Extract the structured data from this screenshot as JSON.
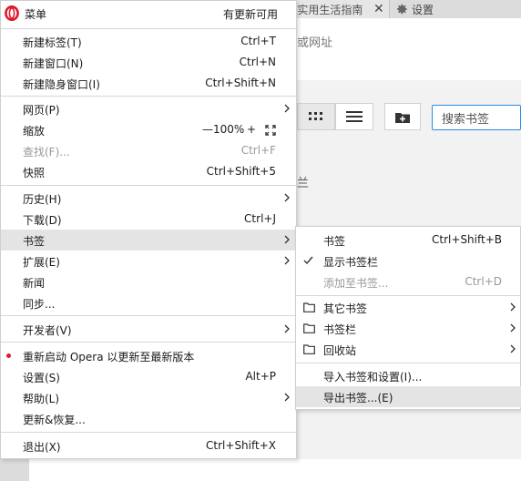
{
  "background": {
    "tab_title": "-实用生活指南",
    "settings_label": "设置",
    "address_fragment": "或网址",
    "bookmark_search_placeholder": "搜索书签",
    "content_fragment": "兰"
  },
  "menu": {
    "title": "菜单",
    "update_status": "有更新可用",
    "items": [
      {
        "label": "新建标签(T)",
        "shortcut": "Ctrl+T"
      },
      {
        "label": "新建窗口(N)",
        "shortcut": "Ctrl+N"
      },
      {
        "label": "新建隐身窗口(I)",
        "shortcut": "Ctrl+Shift+N"
      },
      {
        "label": "网页(P)",
        "shortcut": ""
      },
      {
        "label": "缩放",
        "shortcut": ""
      },
      {
        "label": "查找(F)...",
        "shortcut": "Ctrl+F"
      },
      {
        "label": "快照",
        "shortcut": "Ctrl+Shift+5"
      },
      {
        "label": "历史(H)",
        "shortcut": ""
      },
      {
        "label": "下载(D)",
        "shortcut": "Ctrl+J"
      },
      {
        "label": "书签",
        "shortcut": ""
      },
      {
        "label": "扩展(E)",
        "shortcut": ""
      },
      {
        "label": "新闻",
        "shortcut": ""
      },
      {
        "label": "同步...",
        "shortcut": ""
      },
      {
        "label": "开发者(V)",
        "shortcut": ""
      },
      {
        "label": "重新启动 Opera 以更新至最新版本",
        "shortcut": ""
      },
      {
        "label": "设置(S)",
        "shortcut": "Alt+P"
      },
      {
        "label": "帮助(L)",
        "shortcut": ""
      },
      {
        "label": "更新&恢复...",
        "shortcut": ""
      },
      {
        "label": "退出(X)",
        "shortcut": "Ctrl+Shift+X"
      }
    ],
    "zoom": {
      "minus": "—",
      "value": "100%",
      "plus": "+"
    }
  },
  "bookmarks_submenu": {
    "items": [
      {
        "label": "书签",
        "shortcut": "Ctrl+Shift+B"
      },
      {
        "label": "显示书签栏",
        "shortcut": ""
      },
      {
        "label": "添加至书签...",
        "shortcut": "Ctrl+D"
      },
      {
        "label": "其它书签",
        "shortcut": ""
      },
      {
        "label": "书签栏",
        "shortcut": ""
      },
      {
        "label": "回收站",
        "shortcut": ""
      },
      {
        "label": "导入书签和设置(I)...",
        "shortcut": ""
      },
      {
        "label": "导出书签...(E)",
        "shortcut": ""
      }
    ]
  },
  "colors": {
    "accent": "#2a8be6",
    "opera_red": "#e0192c",
    "hover": "#e4e4e4"
  },
  "icons": [
    "opera-logo-icon",
    "close-icon",
    "gear-icon",
    "grid-view-icon",
    "list-view-icon",
    "add-folder-icon",
    "chevron-right-icon",
    "fullscreen-icon",
    "check-icon",
    "folder-icon"
  ]
}
